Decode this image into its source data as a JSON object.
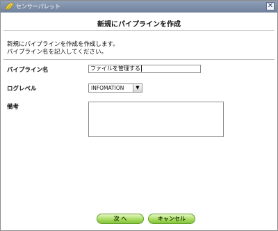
{
  "window": {
    "title": "センサーパレット",
    "close_label": "✕"
  },
  "page": {
    "heading": "新規にパイプラインを作成",
    "intro_line1": "新規にパイプラインを作成を作成します。",
    "intro_line2": "パイプライン名を記入してください。"
  },
  "form": {
    "pipeline_name_label": "パイプライン名",
    "pipeline_name_value": "ファイルを管理する",
    "log_level_label": "ログレベル",
    "log_level_value": "INFOMATION",
    "remarks_label": "備考",
    "remarks_value": ""
  },
  "buttons": {
    "next_label": "次 へ",
    "cancel_label": "キャンセル"
  },
  "icons": {
    "app": "leaf-icon",
    "close": "close-icon",
    "dropdown": "chevron-down-icon"
  },
  "colors": {
    "titlebar": "#7a8ba6",
    "button_green": "#a9dc62"
  }
}
